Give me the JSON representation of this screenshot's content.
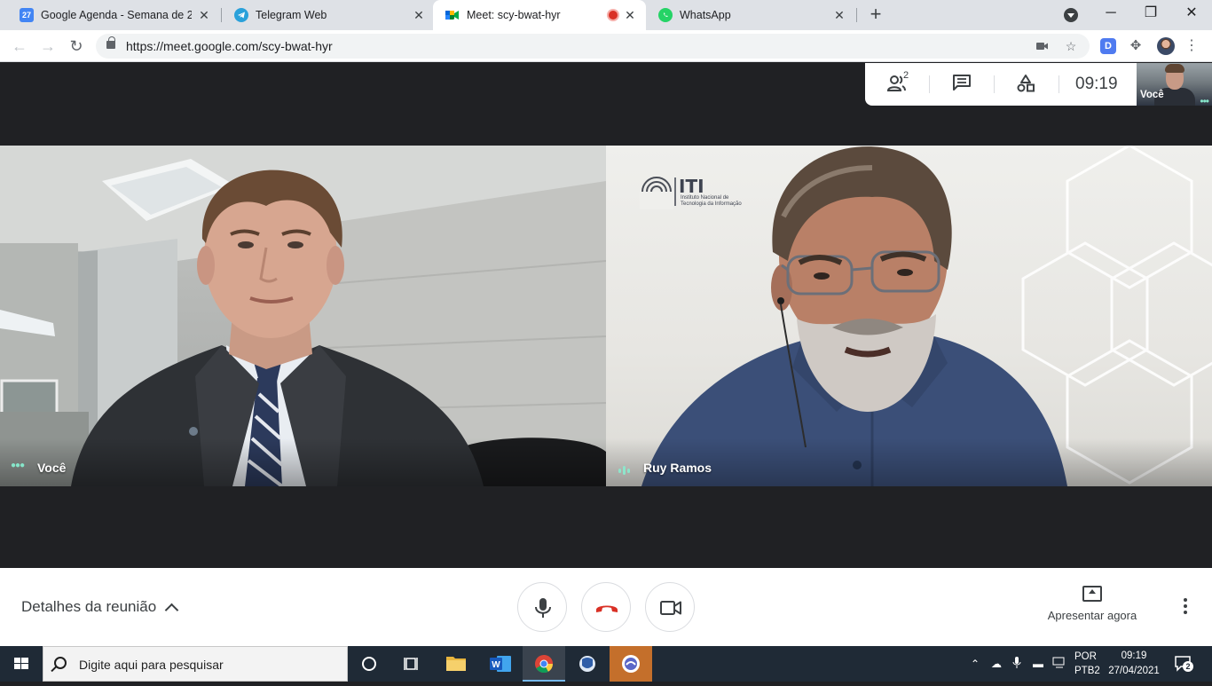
{
  "browser": {
    "tabs": [
      {
        "title": "Google Agenda - Semana de 25 d",
        "favicon": "calendar-icon",
        "favicon_text": "27",
        "active": false
      },
      {
        "title": "Telegram Web",
        "favicon": "telegram-icon",
        "active": false
      },
      {
        "title": "Meet: scy-bwat-hyr",
        "favicon": "meet-icon",
        "active": true,
        "recording": true
      },
      {
        "title": "WhatsApp",
        "favicon": "whatsapp-icon",
        "active": false
      }
    ],
    "url": "https://meet.google.com/scy-bwat-hyr",
    "extension_d_label": "D"
  },
  "meet": {
    "top_info": {
      "participants_count": "2",
      "time": "09:19"
    },
    "self_thumbnail_label": "Você",
    "tiles": [
      {
        "name": "Você",
        "speaking": false
      },
      {
        "name": "Ruy Ramos",
        "speaking": true,
        "logo_title": "ITI",
        "logo_subtitle_line1": "Instituto Nacional de",
        "logo_subtitle_line2": "Tecnologia da Informação"
      }
    ],
    "controls": {
      "details_label": "Detalhes da reunião",
      "present_label": "Apresentar agora"
    }
  },
  "taskbar": {
    "search_placeholder": "Digite aqui para pesquisar",
    "lang_top": "POR",
    "lang_bottom": "PTB2",
    "time": "09:19",
    "date": "27/04/2021",
    "notification_count": "2"
  },
  "colors": {
    "meet_dark": "#202124",
    "hangup_red": "#d93025",
    "speaking_green": "#86e5c9",
    "taskbar": "#1f2a36"
  }
}
